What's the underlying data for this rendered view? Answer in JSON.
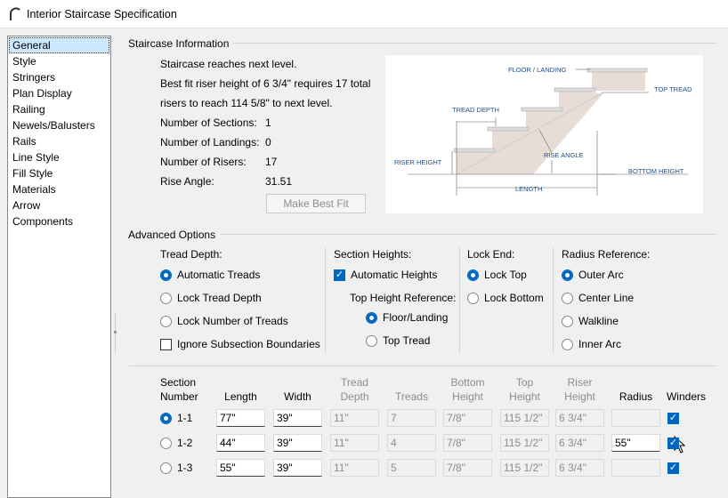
{
  "window": {
    "title": "Interior Staircase Specification"
  },
  "sidebar": {
    "items": [
      "General",
      "Style",
      "Stringers",
      "Plan Display",
      "Railing",
      "Newels/Balusters",
      "Rails",
      "Line Style",
      "Fill Style",
      "Materials",
      "Arrow",
      "Components"
    ],
    "selected": "General"
  },
  "info": {
    "group": "Staircase Information",
    "line1": "Staircase reaches next level.",
    "line2": "Best fit riser height of 6 3/4\" requires 17 total",
    "line3": "risers to reach 114 5/8\" to next level.",
    "rows": [
      {
        "label": "Number of Sections:",
        "value": "1"
      },
      {
        "label": "Number of Landings:",
        "value": "0"
      },
      {
        "label": "Number of Risers:",
        "value": "17"
      },
      {
        "label": "Rise Angle:",
        "value": "31.51"
      }
    ],
    "best_fit_button": "Make Best Fit"
  },
  "diagram": {
    "floor_landing": "FLOOR / LANDING",
    "top_tread": "TOP TREAD",
    "tread_depth": "TREAD DEPTH",
    "riser_height": "RISER HEIGHT",
    "rise_angle": "RISE ANGLE",
    "bottom_height": "BOTTOM HEIGHT",
    "length": "LENGTH"
  },
  "advanced": {
    "group": "Advanced Options",
    "tread_depth": {
      "label": "Tread Depth:",
      "options": [
        "Automatic Treads",
        "Lock Tread Depth",
        "Lock Number of Treads"
      ],
      "selected": 0,
      "ignore_label": "Ignore Subsection Boundaries",
      "ignore_checked": false
    },
    "section_heights": {
      "label": "Section Heights:",
      "auto_label": "Automatic Heights",
      "auto_checked": true,
      "ref_label": "Top Height Reference:",
      "options": [
        "Floor/Landing",
        "Top Tread"
      ],
      "selected": 0
    },
    "lock_end": {
      "label": "Lock End:",
      "options": [
        "Lock Top",
        "Lock Bottom"
      ],
      "selected": 0
    },
    "radius_ref": {
      "label": "Radius Reference:",
      "options": [
        "Outer Arc",
        "Center Line",
        "Walkline",
        "Inner Arc"
      ],
      "selected": 0
    }
  },
  "table": {
    "headers": [
      [
        "Section",
        "Number"
      ],
      [
        "",
        "Length"
      ],
      [
        "",
        "Width"
      ],
      [
        "Tread",
        "Depth"
      ],
      [
        "",
        "Treads"
      ],
      [
        "Bottom",
        "Height"
      ],
      [
        "Top",
        "Height"
      ],
      [
        "Riser",
        "Height"
      ],
      [
        "",
        "Radius"
      ],
      [
        "",
        "Winders"
      ]
    ],
    "rows": [
      {
        "section": "1-1",
        "selected": true,
        "length": "77\"",
        "width": "39\"",
        "tread_depth": "11\"",
        "treads": "7",
        "bottom": "7/8\"",
        "top": "115 1/2\"",
        "riser": "6 3/4\"",
        "radius": "",
        "winders": true
      },
      {
        "section": "1-2",
        "selected": false,
        "length": "44\"",
        "width": "39\"",
        "tread_depth": "11\"",
        "treads": "4",
        "bottom": "7/8\"",
        "top": "115 1/2\"",
        "riser": "6 3/4\"",
        "radius": "55\"",
        "winders": true
      },
      {
        "section": "1-3",
        "selected": false,
        "length": "55\"",
        "width": "39\"",
        "tread_depth": "11\"",
        "treads": "5",
        "bottom": "7/8\"",
        "top": "115 1/2\"",
        "riser": "6 3/4\"",
        "radius": "",
        "winders": true
      }
    ]
  }
}
